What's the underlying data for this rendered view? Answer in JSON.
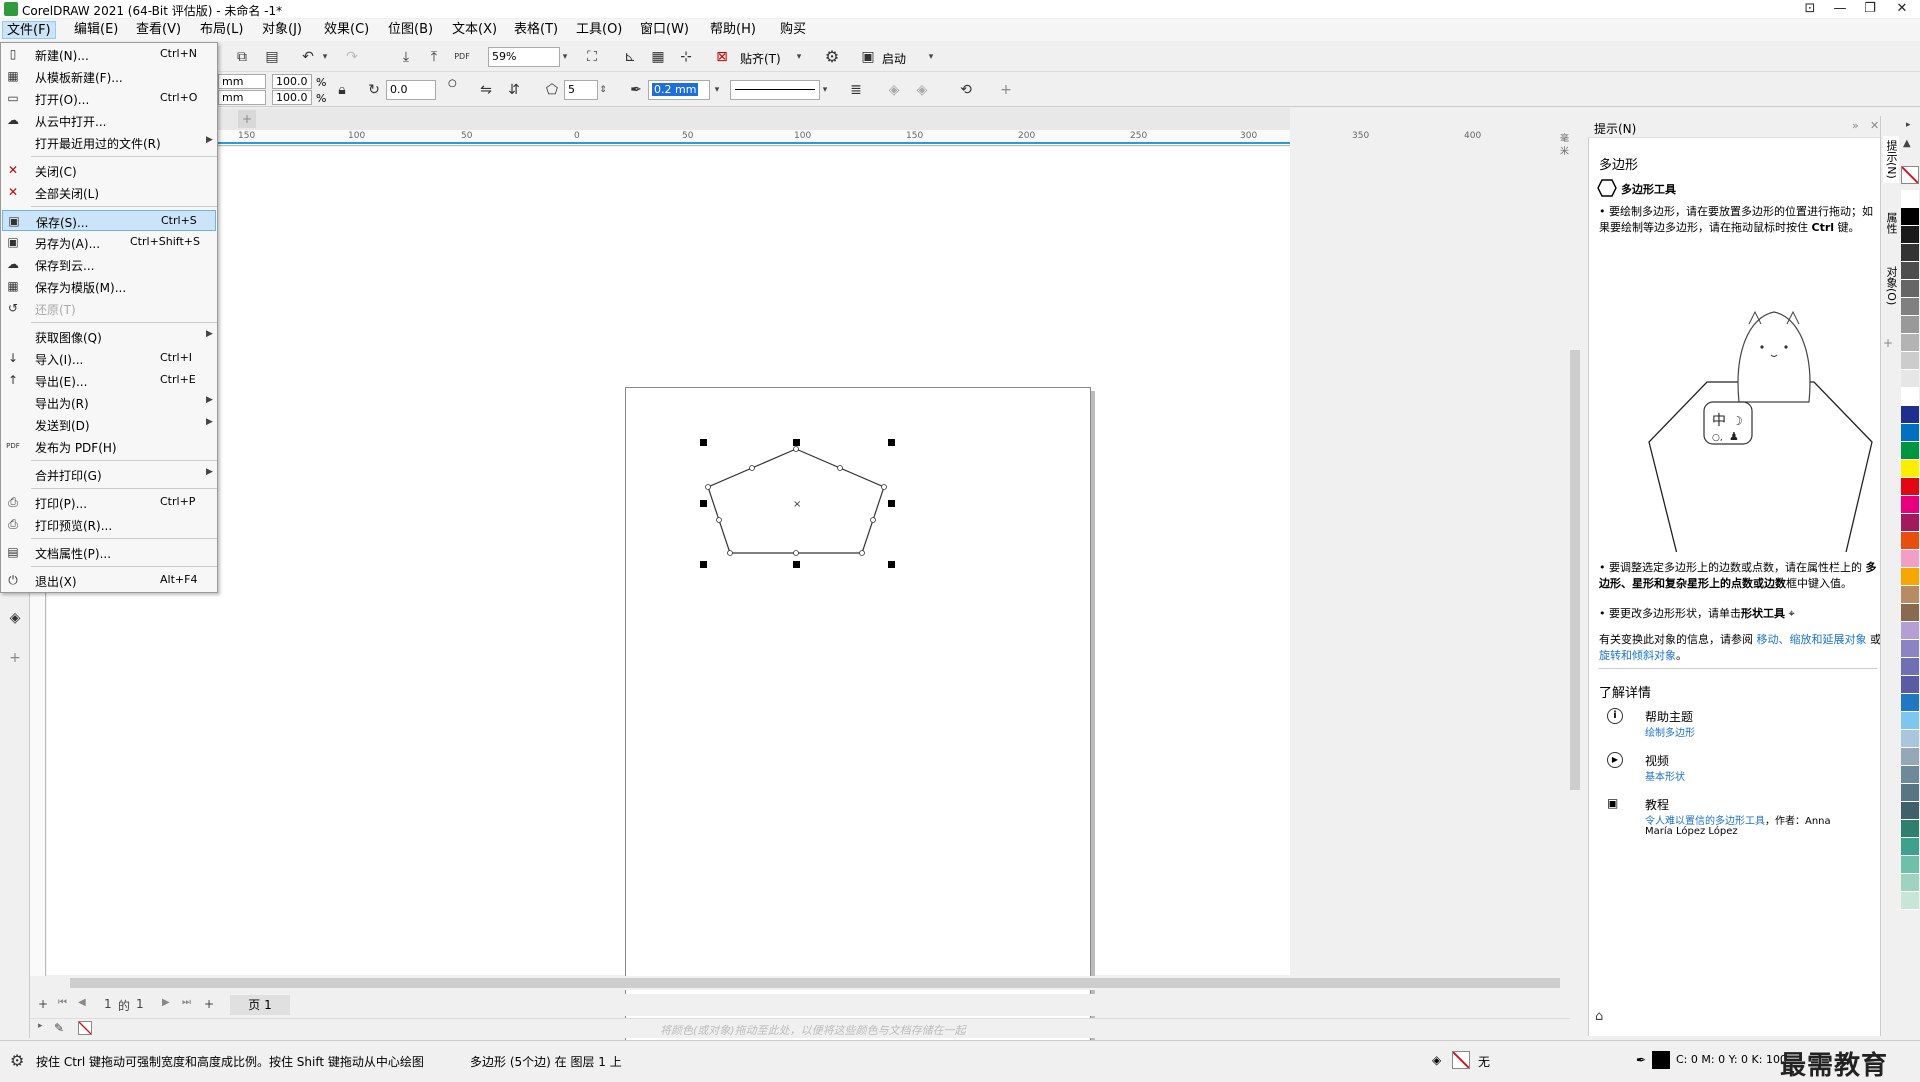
{
  "window": {
    "title": "CorelDRAW 2021 (64-Bit 评估版) - 未命名 -1*",
    "controls": [
      "⊡",
      "—",
      "❐",
      "✕"
    ]
  },
  "menubar": [
    "文件(F)",
    "编辑(E)",
    "查看(V)",
    "布局(L)",
    "对象(J)",
    "效果(C)",
    "位图(B)",
    "文本(X)",
    "表格(T)",
    "工具(O)",
    "窗口(W)",
    "帮助(H)",
    "购买"
  ],
  "toolbar": {
    "zoom": "59%",
    "snap_label": "贴齐(T)",
    "launch_label": "启动",
    "unit1": "mm",
    "unit2": "mm",
    "scale_x": "100.0",
    "scale_y": "100.0",
    "percent": "%",
    "rotation": "0.0",
    "sides": "5",
    "outline_width": "0.2 mm"
  },
  "file_menu": [
    {
      "label": "新建(N)...",
      "shortcut": "Ctrl+N",
      "icon": "new-doc-icon",
      "glyph": "▯"
    },
    {
      "label": "从模板新建(F)...",
      "shortcut": "",
      "icon": "template-icon",
      "glyph": "▦"
    },
    {
      "label": "打开(O)...",
      "shortcut": "Ctrl+O",
      "icon": "open-folder-icon",
      "glyph": "▭"
    },
    {
      "label": "从云中打开...",
      "shortcut": "",
      "icon": "cloud-open-icon",
      "glyph": "☁"
    },
    {
      "label": "打开最近用过的文件(R)",
      "shortcut": "",
      "submenu": true
    },
    {
      "label": "关闭(C)",
      "shortcut": "",
      "icon": "close-doc-icon",
      "glyph": "✕"
    },
    {
      "label": "全部关闭(L)",
      "shortcut": "",
      "icon": "close-all-icon",
      "glyph": "✕"
    },
    {
      "label": "保存(S)...",
      "shortcut": "Ctrl+S",
      "icon": "save-icon",
      "glyph": "▣",
      "highlight": true
    },
    {
      "label": "另存为(A)...",
      "shortcut": "Ctrl+Shift+S",
      "icon": "save-as-icon",
      "glyph": "▣"
    },
    {
      "label": "保存到云...",
      "shortcut": "",
      "icon": "cloud-save-icon",
      "glyph": "☁"
    },
    {
      "label": "保存为模版(M)...",
      "shortcut": "",
      "icon": "save-template-icon",
      "glyph": "▦"
    },
    {
      "label": "还原(T)",
      "shortcut": "",
      "icon": "revert-icon",
      "glyph": "↺",
      "disabled": true
    },
    {
      "label": "获取图像(Q)",
      "shortcut": "",
      "submenu": true
    },
    {
      "label": "导入(I)...",
      "shortcut": "Ctrl+I",
      "icon": "import-icon",
      "glyph": "↓"
    },
    {
      "label": "导出(E)...",
      "shortcut": "Ctrl+E",
      "icon": "export-icon",
      "glyph": "↑"
    },
    {
      "label": "导出为(R)",
      "shortcut": "",
      "submenu": true
    },
    {
      "label": "发送到(D)",
      "shortcut": "",
      "submenu": true
    },
    {
      "label": "发布为 PDF(H)",
      "shortcut": "",
      "icon": "pdf-icon",
      "glyph": "PDF"
    },
    {
      "label": "合并打印(G)",
      "shortcut": "",
      "submenu": true
    },
    {
      "label": "打印(P)...",
      "shortcut": "Ctrl+P",
      "icon": "print-icon",
      "glyph": "⎙"
    },
    {
      "label": "打印预览(R)...",
      "shortcut": "",
      "icon": "print-preview-icon",
      "glyph": "⎙"
    },
    {
      "label": "文档属性(P)...",
      "shortcut": "",
      "icon": "doc-props-icon",
      "glyph": "▤"
    },
    {
      "label": "退出(X)",
      "shortcut": "Alt+F4",
      "icon": "exit-icon",
      "glyph": "⏻"
    }
  ],
  "ruler_ticks": [
    "150",
    "100",
    "50",
    "0",
    "50",
    "100",
    "150",
    "200",
    "250",
    "300",
    "350",
    "400",
    "毫米"
  ],
  "page_nav": {
    "current": "1",
    "of": "的",
    "total": "1",
    "page_tab": "页 1"
  },
  "doc_palette_hint": "将颜色(或对象)拖动至此处，以便将这些颜色与文档存储在一起",
  "status": {
    "hint": "按住 Ctrl 键拖动可强制宽度和高度成比例。按住 Shift 键拖动从中心绘图",
    "selection": "多边形 (5个边) 在 图层 1 上",
    "fill_label": "无",
    "outline_values": "C: 0 M: 0 Y: 0 K: 100"
  },
  "hints_panel": {
    "header": "提示(N)",
    "title": "多边形",
    "tool_name": "多边形工具",
    "bullet1_a": "要绘制多边形，请在要放置多边形的位置进行拖动；如果要绘制等边多边形，请在拖动鼠标时按住 ",
    "bullet1_b": "Ctrl",
    "bullet1_c": " 键。",
    "bullet2_a": "要调整选定多边形上的边数或点数，请在属性栏上的 ",
    "bullet2_b": "多边形、星形和复杂星形上的点数或边数",
    "bullet2_c": "框中键入值。",
    "bullet3_a": "要更改多边形形状，请单击",
    "bullet3_b": "形状工具",
    "more_info_a": "有关变换此对象的信息，请参阅 ",
    "more_info_link1": "移动、缩放和延展对象",
    "more_info_b": " 或 ",
    "more_info_link2": "旋转和倾斜对象",
    "more_info_c": "。",
    "learn_more": "了解详情",
    "help_title": "帮助主题",
    "help_link": "绘制多边形",
    "video_title": "视频",
    "video_link": "基本形状",
    "tutorial_title": "教程",
    "tutorial_link": "令人难以置信的多边形工具",
    "tutorial_author_a": "，作者：Anna",
    "tutorial_author_b": "María López López",
    "cat_label": "中"
  },
  "side_tabs": [
    "提示(N)",
    "属性",
    "对象(O)"
  ],
  "palette_colors": [
    "#ffffff",
    "#000000",
    "#1a1a1a",
    "#333333",
    "#4d4d4d",
    "#666666",
    "#808080",
    "#999999",
    "#b3b3b3",
    "#cccccc",
    "#e6e6e6",
    "#ffffff",
    "#1f2f8f",
    "#0070c0",
    "#009640",
    "#ffed00",
    "#e30613",
    "#e6007e",
    "#a3195b",
    "#e84e0f",
    "#f29fc5",
    "#f7a600",
    "#b98b64",
    "#8a6a4f",
    "#b49ed3",
    "#8b84c2",
    "#6f6fb3",
    "#5b5ba3",
    "#1f78c1",
    "#7fc6ef",
    "#a9c6dc",
    "#94a8b8",
    "#6e8a9a",
    "#577582",
    "#3f5f6a",
    "#2f7f6f",
    "#3fa08e",
    "#6fc0a9",
    "#9fd3bf",
    "#c8e6d8"
  ],
  "watermark": "最需教育"
}
